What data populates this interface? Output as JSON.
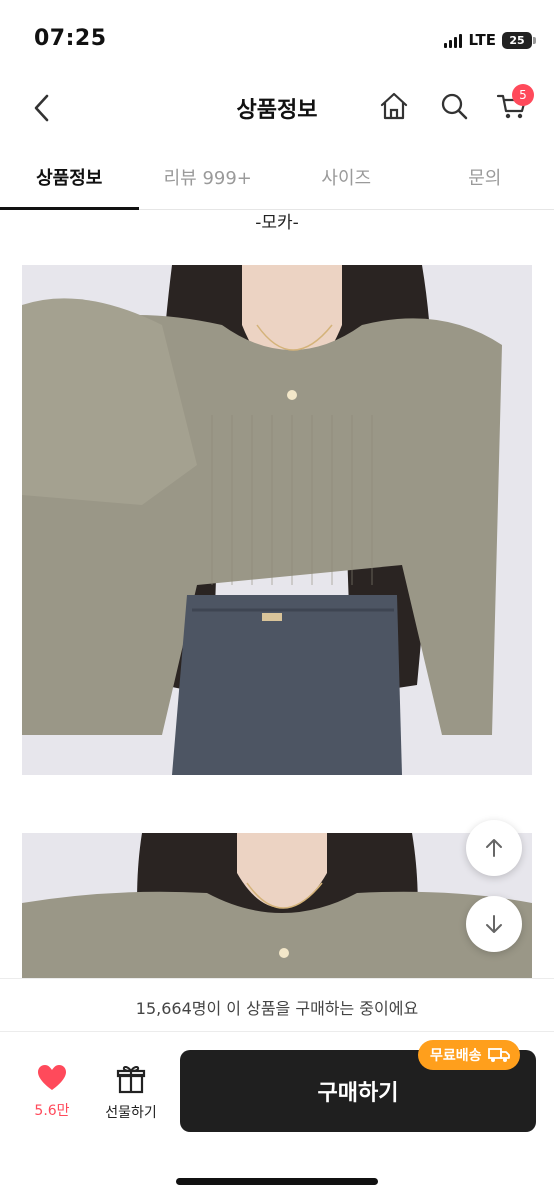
{
  "status_bar": {
    "time": "07:25",
    "network": "LTE",
    "battery": "25"
  },
  "header": {
    "title": "상품정보",
    "cart_count": "5"
  },
  "tabs": [
    {
      "label": "상품정보",
      "active": true
    },
    {
      "label": "리뷰 999+",
      "active": false
    },
    {
      "label": "사이즈",
      "active": false
    },
    {
      "label": "문의",
      "active": false
    }
  ],
  "content": {
    "color_caption": "-모카-"
  },
  "notice": {
    "text": "15,664명이 이 상품을 구매하는 중이에요"
  },
  "actions": {
    "like_count": "5.6만",
    "gift_label": "선물하기",
    "buy_label": "구매하기",
    "free_shipping": "무료배송"
  },
  "colors": {
    "accent": "#ff4a5b",
    "buy_button": "#1f1f1f",
    "shipping_badge": "#ff9f1c"
  },
  "icons": [
    "back-icon",
    "home-icon",
    "search-icon",
    "cart-icon",
    "arrow-up-icon",
    "arrow-down-icon",
    "heart-icon",
    "gift-icon",
    "truck-icon"
  ]
}
